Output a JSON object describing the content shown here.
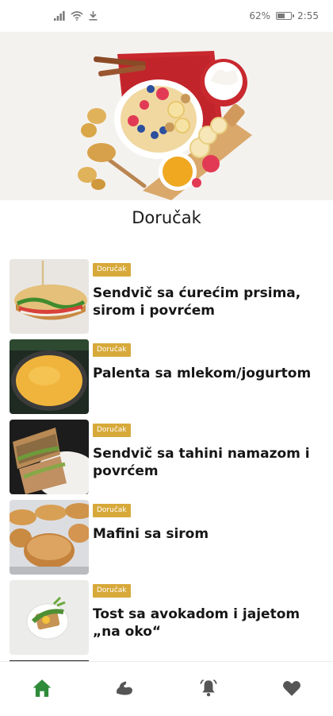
{
  "status_bar": {
    "battery_percent": "62%",
    "time": "2:55",
    "battery_level": 0.62
  },
  "page": {
    "title": "Doručak"
  },
  "recipes": [
    {
      "category": "Doručak",
      "title": "Sendvič sa ćurećim prsima, sirom i povrćem"
    },
    {
      "category": "Doručak",
      "title": "Palenta sa mlekom/jogurtom"
    },
    {
      "category": "Doručak",
      "title": "Sendvič sa tahini namazom i povrćem"
    },
    {
      "category": "Doručak",
      "title": "Mafini sa sirom"
    },
    {
      "category": "Doručak",
      "title": "Tost sa avokadom i jajetom „na oko“"
    }
  ],
  "bottom_nav": {
    "items": [
      {
        "icon": "home-icon",
        "active": true
      },
      {
        "icon": "muscle-icon",
        "active": false
      },
      {
        "icon": "bell-icon",
        "active": false
      },
      {
        "icon": "heart-icon",
        "active": false
      }
    ]
  },
  "colors": {
    "badge": "#d7a93a",
    "nav_active": "#2e8b3a",
    "nav_inactive": "#555555"
  }
}
